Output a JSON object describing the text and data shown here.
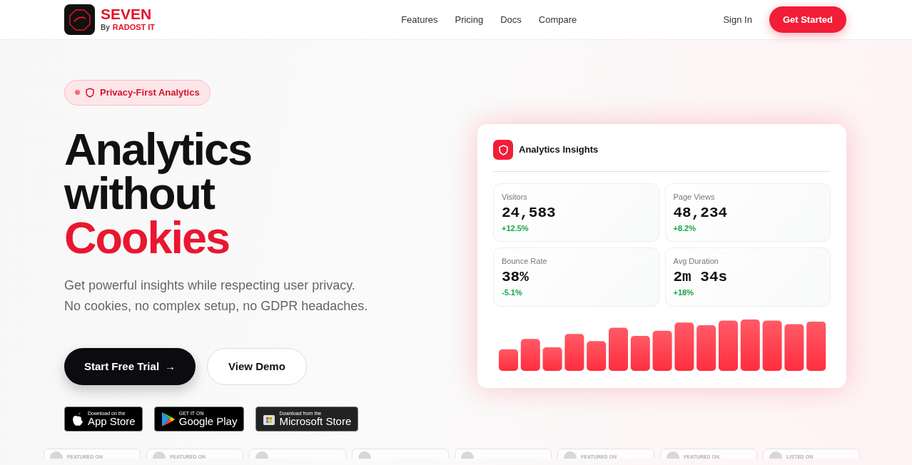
{
  "brand": {
    "name": "SEVEN",
    "by": "By",
    "company": "RADOST IT"
  },
  "nav": {
    "links": [
      "Features",
      "Pricing",
      "Docs",
      "Compare"
    ],
    "sign_in": "Sign In",
    "cta": "Get Started"
  },
  "hero": {
    "badge": "Privacy-First Analytics",
    "headline": [
      "Analytics",
      "without"
    ],
    "highlight": "Cookies",
    "subtitle": "Get powerful insights while respecting user privacy.\nNo cookies, no complex setup, no GDPR headaches.",
    "buttons": [
      {
        "kind": "primary",
        "label": "Start Free Trial",
        "arrow": "→"
      },
      {
        "kind": "outline",
        "label": "View Demo"
      }
    ],
    "stores": [
      {
        "kind": "apple",
        "small": "Download on the",
        "big": "App Store"
      },
      {
        "kind": "google",
        "small": "GET IT ON",
        "big": "Google Play"
      },
      {
        "kind": "microsoft",
        "small": "Download from the",
        "big": "Microsoft Store"
      }
    ]
  },
  "insights": {
    "title": "Analytics Insights",
    "stats": [
      {
        "label": "Visitors",
        "value": "24,583",
        "change": "+12.5%"
      },
      {
        "label": "Page Views",
        "value": "48,234",
        "change": "+8.2%"
      },
      {
        "label": "Bounce Rate",
        "value": "38%",
        "change": "-5.1%"
      },
      {
        "label": "Avg Duration",
        "value": "2m 34s",
        "change": "+18%"
      }
    ]
  },
  "featured": [
    {
      "kind": "labelled",
      "text": "FEATURED ON"
    },
    {
      "kind": "labelled",
      "text": "FEATURED ON"
    },
    {
      "kind": "logo"
    },
    {
      "kind": "logo"
    },
    {
      "kind": "logo"
    },
    {
      "kind": "labelled",
      "text": "FEATURED ON"
    },
    {
      "kind": "labelled",
      "text": "FEATURED ON"
    },
    {
      "kind": "labelled",
      "text": "LISTED ON"
    }
  ]
}
